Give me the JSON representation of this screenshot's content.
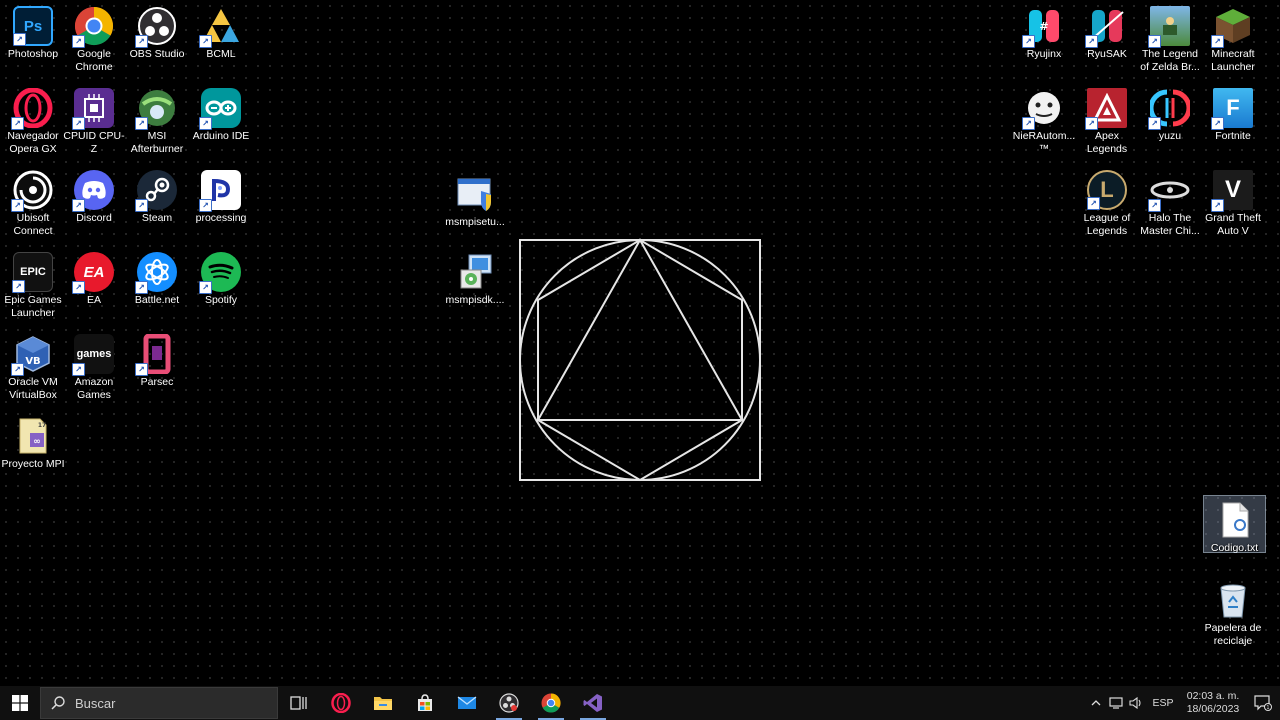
{
  "desktop": {
    "icons_left": [
      {
        "label": "Photoshop",
        "glyph": "Ps",
        "bg": "#001e36",
        "fg": "#31a8ff",
        "icon": "photoshop-icon"
      },
      {
        "label": "Google Chrome",
        "glyph": "",
        "bg": "",
        "fg": "",
        "icon": "chrome-icon"
      },
      {
        "label": "OBS Studio",
        "glyph": "",
        "bg": "",
        "fg": "",
        "icon": "obs-icon"
      },
      {
        "label": "BCML",
        "glyph": "",
        "bg": "",
        "fg": "",
        "icon": "triforce-icon"
      },
      {
        "label": "Navegador Opera GX",
        "glyph": "",
        "bg": "",
        "fg": "",
        "icon": "opera-gx-icon"
      },
      {
        "label": "CPUID CPU-Z",
        "glyph": "",
        "bg": "#5a2d91",
        "fg": "",
        "icon": "cpu-z-icon"
      },
      {
        "label": "MSI Afterburner",
        "glyph": "",
        "bg": "",
        "fg": "",
        "icon": "msi-afterburner-icon"
      },
      {
        "label": "Arduino IDE",
        "glyph": "",
        "bg": "#00979c",
        "fg": "",
        "icon": "arduino-icon"
      },
      {
        "label": "Ubisoft Connect",
        "glyph": "",
        "bg": "",
        "fg": "",
        "icon": "ubisoft-icon"
      },
      {
        "label": "Discord",
        "glyph": "",
        "bg": "#5865f2",
        "fg": "",
        "icon": "discord-icon"
      },
      {
        "label": "Steam",
        "glyph": "",
        "bg": "#1b2838",
        "fg": "",
        "icon": "steam-icon"
      },
      {
        "label": "processing",
        "glyph": "",
        "bg": "#ffffff",
        "fg": "",
        "icon": "processing-icon"
      },
      {
        "label": "Epic Games Launcher",
        "glyph": "EPIC",
        "bg": "#111111",
        "fg": "#ffffff",
        "icon": "epic-games-icon"
      },
      {
        "label": "EA",
        "glyph": "EA",
        "bg": "#e8192c",
        "fg": "#ffffff",
        "icon": "ea-icon"
      },
      {
        "label": "Battle.net",
        "glyph": "",
        "bg": "#148eff",
        "fg": "",
        "icon": "battlenet-icon"
      },
      {
        "label": "Spotify",
        "glyph": "",
        "bg": "#1db954",
        "fg": "",
        "icon": "spotify-icon"
      },
      {
        "label": "Oracle VM VirtualBox",
        "glyph": "",
        "bg": "",
        "fg": "",
        "icon": "virtualbox-icon"
      },
      {
        "label": "Amazon Games",
        "glyph": "games",
        "bg": "#111111",
        "fg": "#ffffff",
        "icon": "amazon-games-icon"
      },
      {
        "label": "Parsec",
        "glyph": "",
        "bg": "",
        "fg": "",
        "icon": "parsec-icon"
      },
      {
        "label": "Proyecto MPI",
        "glyph": "",
        "bg": "",
        "fg": "",
        "icon": "visual-studio-project-icon"
      }
    ],
    "icons_middle": [
      {
        "label": "msmpisetu...",
        "icon": "installer-shield-icon"
      },
      {
        "label": "msmpisdk....",
        "icon": "msi-installer-icon"
      }
    ],
    "icons_right": [
      {
        "label": "Ryujinx",
        "icon": "ryujinx-icon"
      },
      {
        "label": "RyuSAK",
        "icon": "ryusak-icon"
      },
      {
        "label": "The Legend of Zelda Br...",
        "icon": "zelda-icon"
      },
      {
        "label": "Minecraft Launcher",
        "icon": "minecraft-icon"
      },
      {
        "label": "NieRAutom... ™",
        "icon": "nier-icon"
      },
      {
        "label": "Apex Legends",
        "icon": "apex-icon"
      },
      {
        "label": "yuzu",
        "icon": "yuzu-icon"
      },
      {
        "label": "Fortnite",
        "glyph": "F",
        "icon": "fortnite-icon"
      },
      {
        "label": "League of Legends",
        "glyph": "L",
        "icon": "league-icon"
      },
      {
        "label": "Halo The Master Chi...",
        "icon": "halo-icon"
      },
      {
        "label": "Grand Theft Auto V",
        "glyph": "V",
        "icon": "gta-icon"
      }
    ],
    "selected_file": {
      "label": "Codigo.txt",
      "icon": "text-file-icon"
    },
    "recycle_bin": {
      "label": "Papelera de reciclaje",
      "icon": "recycle-bin-icon"
    }
  },
  "taskbar": {
    "search_placeholder": "Buscar",
    "apps": [
      {
        "name": "task-view",
        "icon": "task-view-icon"
      },
      {
        "name": "opera-gx",
        "icon": "opera-gx-icon"
      },
      {
        "name": "file-explorer",
        "icon": "folder-icon"
      },
      {
        "name": "microsoft-store",
        "icon": "store-icon"
      },
      {
        "name": "mail",
        "icon": "mail-icon"
      },
      {
        "name": "obs-studio",
        "icon": "obs-icon"
      },
      {
        "name": "google-chrome",
        "icon": "chrome-icon"
      },
      {
        "name": "visual-studio",
        "icon": "visual-studio-icon"
      }
    ],
    "tray": {
      "language": "ESP",
      "time": "02:03 a. m.",
      "date": "18/06/2023",
      "notification_count": "1"
    }
  }
}
